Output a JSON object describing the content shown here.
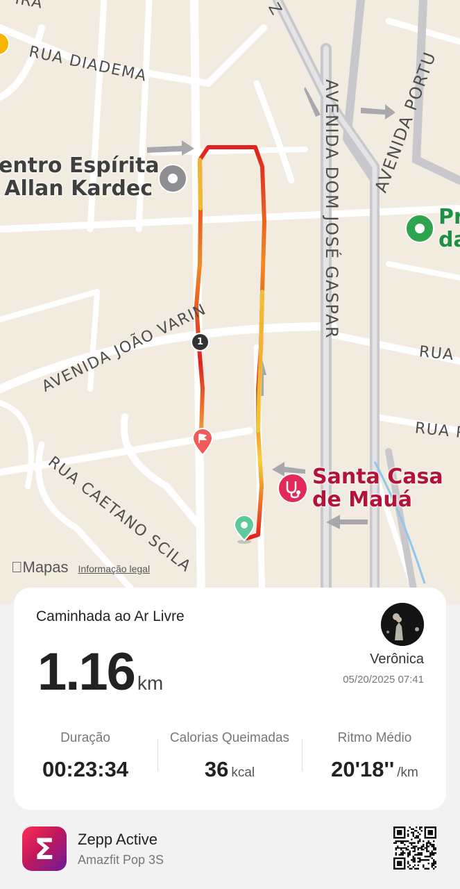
{
  "map": {
    "streets": {
      "rua_diadema": "RUA DIADEMA",
      "avenida_joao_varin": "AVENIDA JOÃO VARIN",
      "rua_caetano_scila": "RUA CAETANO SCILA",
      "avenida_dom_jose_gaspar": "AVENIDA DOM JOSÉ GASPAR",
      "avenida_portu": "AVENIDA PORTU",
      "rua_right_1": "RUA",
      "rua_right_2": "RUA P",
      "top_fragment_left": "IRA",
      "top_fragment_z": "Z"
    },
    "pois": {
      "centro_espirita": {
        "line1": "entro Espírita",
        "line2": "Allan Kardec"
      },
      "santa_casa": {
        "line1": "Santa Casa",
        "line2": "de Mauá"
      },
      "green_poi": {
        "line1": "Pr",
        "line2": "da"
      }
    },
    "marker_lap": "1",
    "brand": "Mapas",
    "legal": "Informação legal",
    "colors": {
      "route_fast": "#f6d13a",
      "route_mid": "#f08a24",
      "route_slow": "#e0221f",
      "start_pin": "#5ec99a",
      "end_pin": "#f05a5a"
    }
  },
  "activity": {
    "title": "Caminhada ao Ar Livre",
    "distance": "1.16",
    "distance_unit": "km",
    "user": "Verônica",
    "date": "05/20/2025 07:41",
    "stats": [
      {
        "label": "Duração",
        "value": "00:23:34",
        "unit": ""
      },
      {
        "label": "Calorias Queimadas",
        "value": "36",
        "unit": "kcal"
      },
      {
        "label": "Ritmo Médio",
        "value": "20'18''",
        "unit": "/km"
      }
    ]
  },
  "footer": {
    "app_icon_glyph": "Σ",
    "app_name": "Zepp Active",
    "device": "Amazfit Pop 3S"
  }
}
